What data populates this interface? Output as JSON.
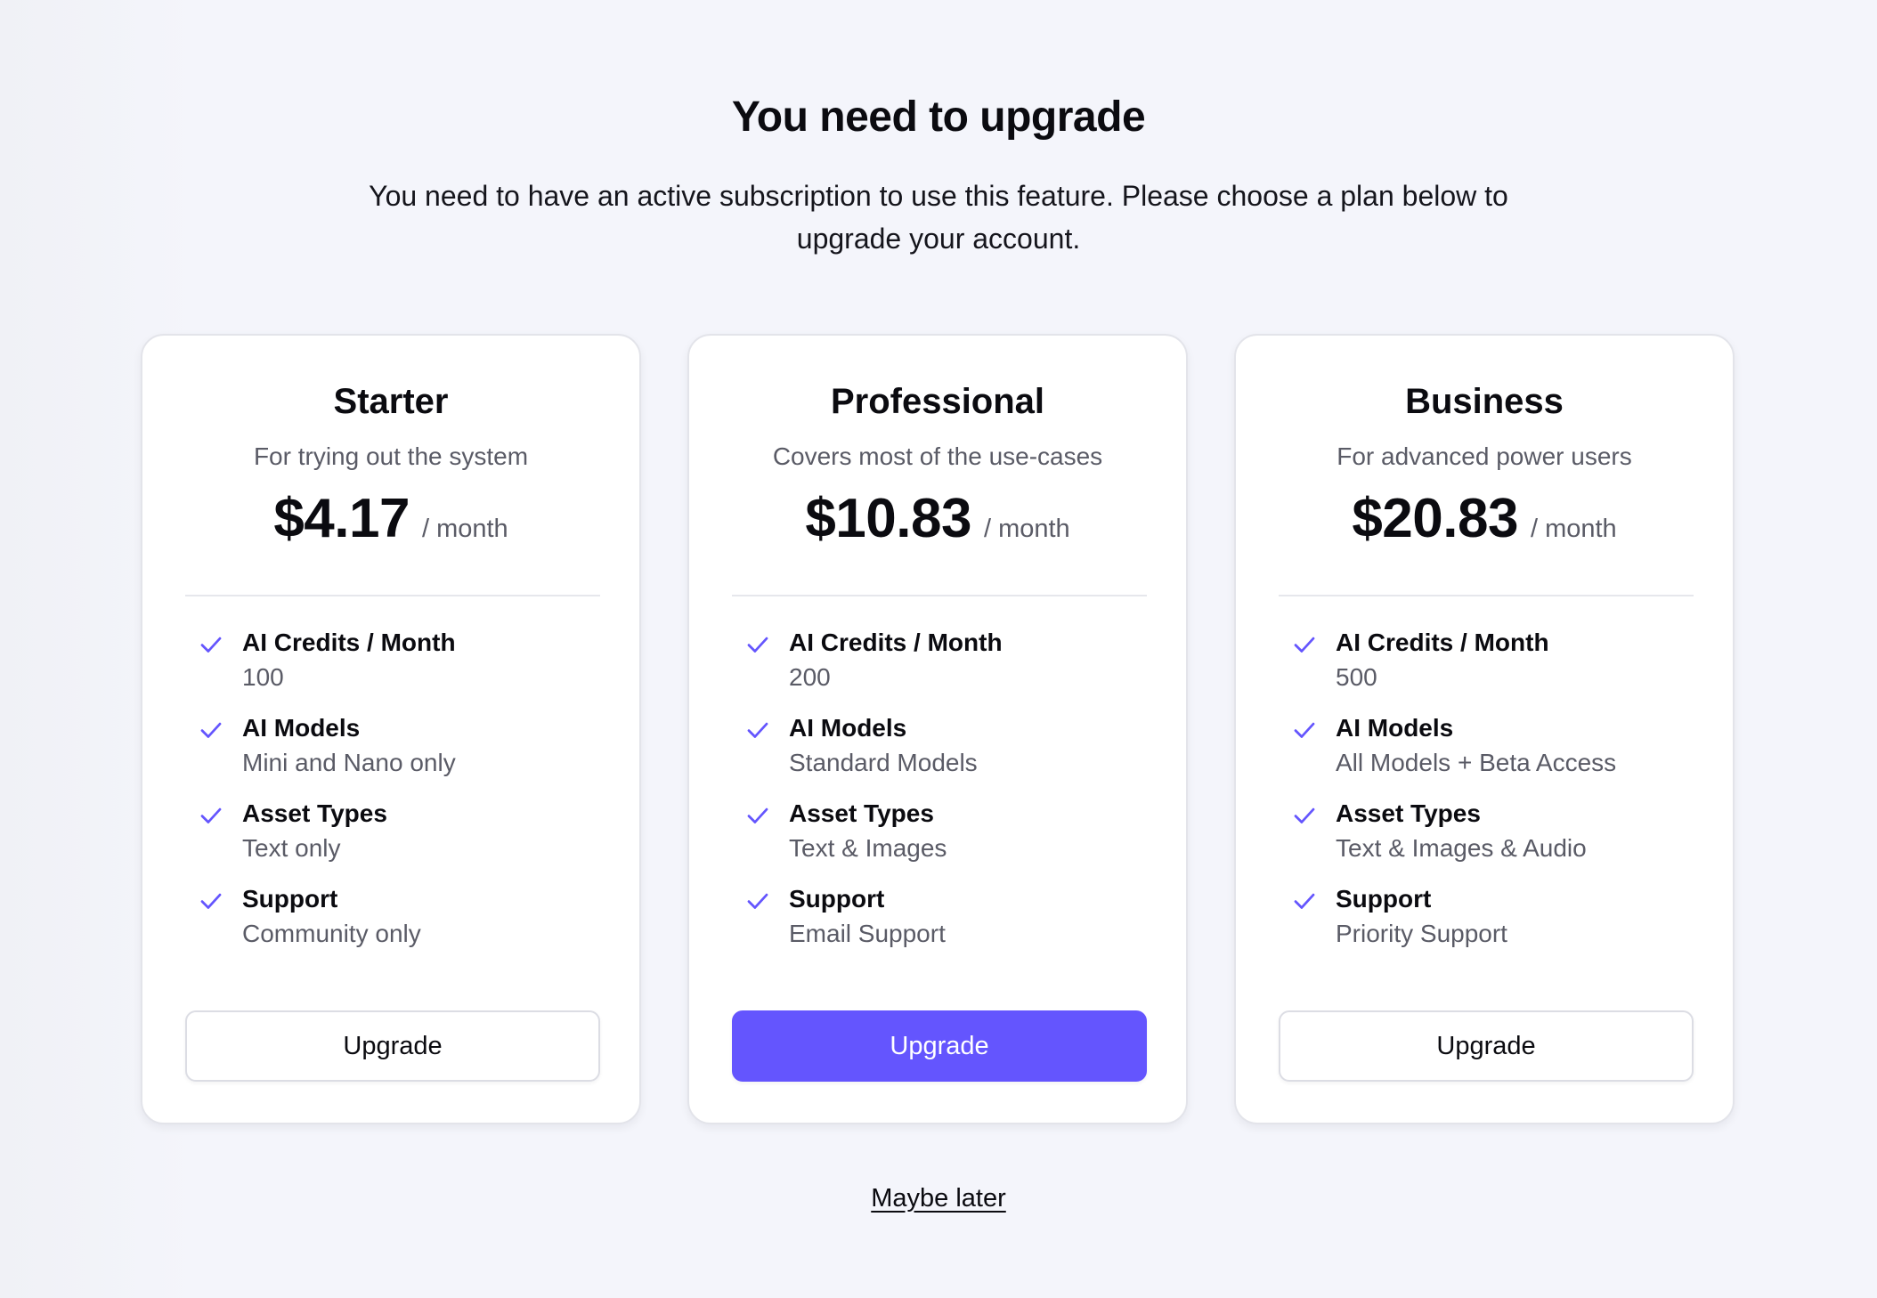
{
  "header": {
    "title": "You need to upgrade",
    "subtitle": "You need to have an active subscription to use this feature. Please choose a plan below to upgrade your account."
  },
  "theme": {
    "accent": "#6455fe",
    "check_color": "#6455fe"
  },
  "plans": [
    {
      "name": "Starter",
      "description": "For trying out the system",
      "price": "$4.17",
      "period": "/  month",
      "button_label": "Upgrade",
      "highlighted": false,
      "features": [
        {
          "name": "AI Credits / Month",
          "value": "100",
          "icon": "check-icon"
        },
        {
          "name": "AI Models",
          "value": "Mini and Nano only",
          "icon": "check-icon"
        },
        {
          "name": "Asset Types",
          "value": "Text only",
          "icon": "check-icon"
        },
        {
          "name": "Support",
          "value": "Community only",
          "icon": "check-icon"
        }
      ]
    },
    {
      "name": "Professional",
      "description": "Covers most of the use-cases",
      "price": "$10.83",
      "period": "/  month",
      "button_label": "Upgrade",
      "highlighted": true,
      "features": [
        {
          "name": "AI Credits / Month",
          "value": "200",
          "icon": "check-icon"
        },
        {
          "name": "AI Models",
          "value": "Standard Models",
          "icon": "check-icon"
        },
        {
          "name": "Asset Types",
          "value": "Text & Images",
          "icon": "check-icon"
        },
        {
          "name": "Support",
          "value": "Email Support",
          "icon": "check-icon"
        }
      ]
    },
    {
      "name": "Business",
      "description": "For advanced power users",
      "price": "$20.83",
      "period": "/  month",
      "button_label": "Upgrade",
      "highlighted": false,
      "features": [
        {
          "name": "AI Credits / Month",
          "value": "500",
          "icon": "check-icon"
        },
        {
          "name": "AI Models",
          "value": "All Models + Beta Access",
          "icon": "check-icon"
        },
        {
          "name": "Asset Types",
          "value": "Text & Images & Audio",
          "icon": "check-icon"
        },
        {
          "name": "Support",
          "value": "Priority Support",
          "icon": "check-icon"
        }
      ]
    }
  ],
  "footer": {
    "dismiss_label": "Maybe later"
  }
}
